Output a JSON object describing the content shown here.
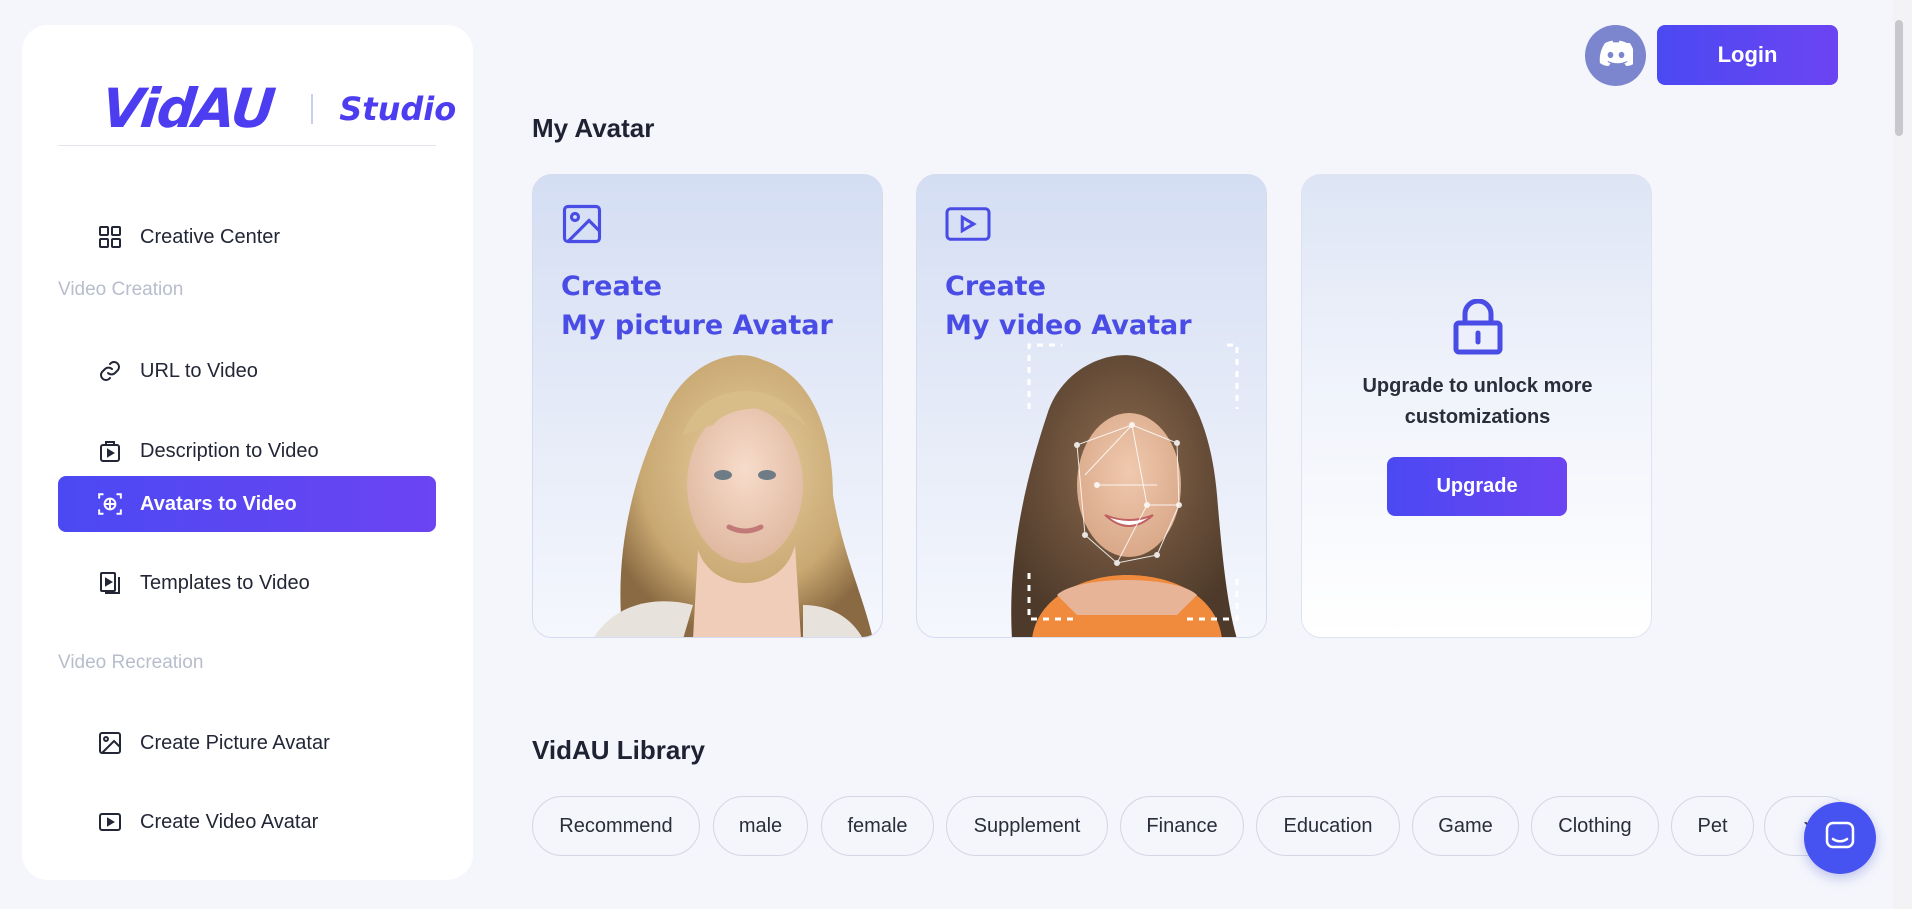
{
  "brand": {
    "logo": "VidAU",
    "studio": "Studio"
  },
  "sidebar": {
    "creative_center": "Creative Center",
    "section_creation": "Video Creation",
    "url_to_video": "URL to Video",
    "description_to_video": "Description to Video",
    "avatars_to_video": "Avatars to Video",
    "templates_to_video": "Templates to Video",
    "section_recreation": "Video Recreation",
    "create_picture_avatar": "Create Picture Avatar",
    "create_video_avatar": "Create Video Avatar"
  },
  "header": {
    "login": "Login",
    "discord_icon": "discord-icon"
  },
  "my_avatar": {
    "title": "My Avatar",
    "picture_card": {
      "line1": "Create",
      "line2": "My picture Avatar"
    },
    "video_card": {
      "line1": "Create",
      "line2": "My video Avatar"
    },
    "upgrade_card": {
      "line1": "Upgrade to unlock more",
      "line2": "customizations",
      "button": "Upgrade"
    }
  },
  "library": {
    "title": "VidAU Library",
    "chips": [
      "Recommend",
      "male",
      "female",
      "Supplement",
      "Finance",
      "Education",
      "Game",
      "Clothing",
      "Pet"
    ]
  },
  "colors": {
    "accent": "#4b49f3",
    "accent_end": "#6c44f2",
    "muted": "#b8bdcc"
  }
}
